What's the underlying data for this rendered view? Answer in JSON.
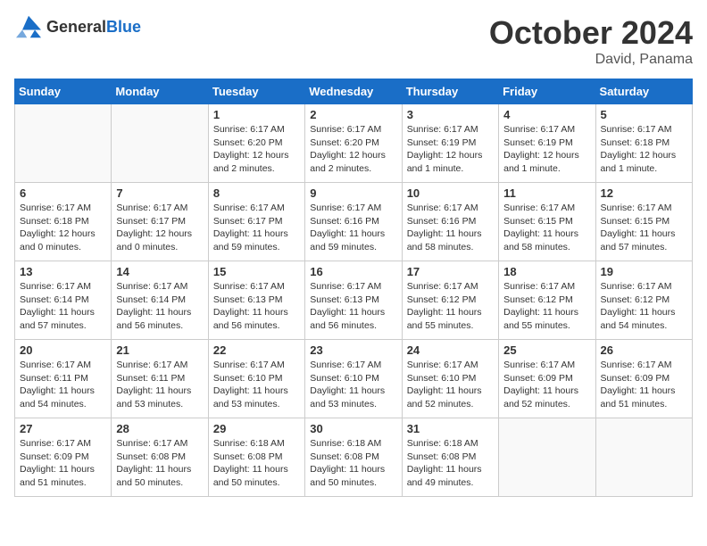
{
  "logo": {
    "general": "General",
    "blue": "Blue"
  },
  "header": {
    "month": "October 2024",
    "location": "David, Panama"
  },
  "weekdays": [
    "Sunday",
    "Monday",
    "Tuesday",
    "Wednesday",
    "Thursday",
    "Friday",
    "Saturday"
  ],
  "weeks": [
    [
      {
        "day": "",
        "info": ""
      },
      {
        "day": "",
        "info": ""
      },
      {
        "day": "1",
        "info": "Sunrise: 6:17 AM\nSunset: 6:20 PM\nDaylight: 12 hours\nand 2 minutes."
      },
      {
        "day": "2",
        "info": "Sunrise: 6:17 AM\nSunset: 6:20 PM\nDaylight: 12 hours\nand 2 minutes."
      },
      {
        "day": "3",
        "info": "Sunrise: 6:17 AM\nSunset: 6:19 PM\nDaylight: 12 hours\nand 1 minute."
      },
      {
        "day": "4",
        "info": "Sunrise: 6:17 AM\nSunset: 6:19 PM\nDaylight: 12 hours\nand 1 minute."
      },
      {
        "day": "5",
        "info": "Sunrise: 6:17 AM\nSunset: 6:18 PM\nDaylight: 12 hours\nand 1 minute."
      }
    ],
    [
      {
        "day": "6",
        "info": "Sunrise: 6:17 AM\nSunset: 6:18 PM\nDaylight: 12 hours\nand 0 minutes."
      },
      {
        "day": "7",
        "info": "Sunrise: 6:17 AM\nSunset: 6:17 PM\nDaylight: 12 hours\nand 0 minutes."
      },
      {
        "day": "8",
        "info": "Sunrise: 6:17 AM\nSunset: 6:17 PM\nDaylight: 11 hours\nand 59 minutes."
      },
      {
        "day": "9",
        "info": "Sunrise: 6:17 AM\nSunset: 6:16 PM\nDaylight: 11 hours\nand 59 minutes."
      },
      {
        "day": "10",
        "info": "Sunrise: 6:17 AM\nSunset: 6:16 PM\nDaylight: 11 hours\nand 58 minutes."
      },
      {
        "day": "11",
        "info": "Sunrise: 6:17 AM\nSunset: 6:15 PM\nDaylight: 11 hours\nand 58 minutes."
      },
      {
        "day": "12",
        "info": "Sunrise: 6:17 AM\nSunset: 6:15 PM\nDaylight: 11 hours\nand 57 minutes."
      }
    ],
    [
      {
        "day": "13",
        "info": "Sunrise: 6:17 AM\nSunset: 6:14 PM\nDaylight: 11 hours\nand 57 minutes."
      },
      {
        "day": "14",
        "info": "Sunrise: 6:17 AM\nSunset: 6:14 PM\nDaylight: 11 hours\nand 56 minutes."
      },
      {
        "day": "15",
        "info": "Sunrise: 6:17 AM\nSunset: 6:13 PM\nDaylight: 11 hours\nand 56 minutes."
      },
      {
        "day": "16",
        "info": "Sunrise: 6:17 AM\nSunset: 6:13 PM\nDaylight: 11 hours\nand 56 minutes."
      },
      {
        "day": "17",
        "info": "Sunrise: 6:17 AM\nSunset: 6:12 PM\nDaylight: 11 hours\nand 55 minutes."
      },
      {
        "day": "18",
        "info": "Sunrise: 6:17 AM\nSunset: 6:12 PM\nDaylight: 11 hours\nand 55 minutes."
      },
      {
        "day": "19",
        "info": "Sunrise: 6:17 AM\nSunset: 6:12 PM\nDaylight: 11 hours\nand 54 minutes."
      }
    ],
    [
      {
        "day": "20",
        "info": "Sunrise: 6:17 AM\nSunset: 6:11 PM\nDaylight: 11 hours\nand 54 minutes."
      },
      {
        "day": "21",
        "info": "Sunrise: 6:17 AM\nSunset: 6:11 PM\nDaylight: 11 hours\nand 53 minutes."
      },
      {
        "day": "22",
        "info": "Sunrise: 6:17 AM\nSunset: 6:10 PM\nDaylight: 11 hours\nand 53 minutes."
      },
      {
        "day": "23",
        "info": "Sunrise: 6:17 AM\nSunset: 6:10 PM\nDaylight: 11 hours\nand 53 minutes."
      },
      {
        "day": "24",
        "info": "Sunrise: 6:17 AM\nSunset: 6:10 PM\nDaylight: 11 hours\nand 52 minutes."
      },
      {
        "day": "25",
        "info": "Sunrise: 6:17 AM\nSunset: 6:09 PM\nDaylight: 11 hours\nand 52 minutes."
      },
      {
        "day": "26",
        "info": "Sunrise: 6:17 AM\nSunset: 6:09 PM\nDaylight: 11 hours\nand 51 minutes."
      }
    ],
    [
      {
        "day": "27",
        "info": "Sunrise: 6:17 AM\nSunset: 6:09 PM\nDaylight: 11 hours\nand 51 minutes."
      },
      {
        "day": "28",
        "info": "Sunrise: 6:17 AM\nSunset: 6:08 PM\nDaylight: 11 hours\nand 50 minutes."
      },
      {
        "day": "29",
        "info": "Sunrise: 6:18 AM\nSunset: 6:08 PM\nDaylight: 11 hours\nand 50 minutes."
      },
      {
        "day": "30",
        "info": "Sunrise: 6:18 AM\nSunset: 6:08 PM\nDaylight: 11 hours\nand 50 minutes."
      },
      {
        "day": "31",
        "info": "Sunrise: 6:18 AM\nSunset: 6:08 PM\nDaylight: 11 hours\nand 49 minutes."
      },
      {
        "day": "",
        "info": ""
      },
      {
        "day": "",
        "info": ""
      }
    ]
  ]
}
